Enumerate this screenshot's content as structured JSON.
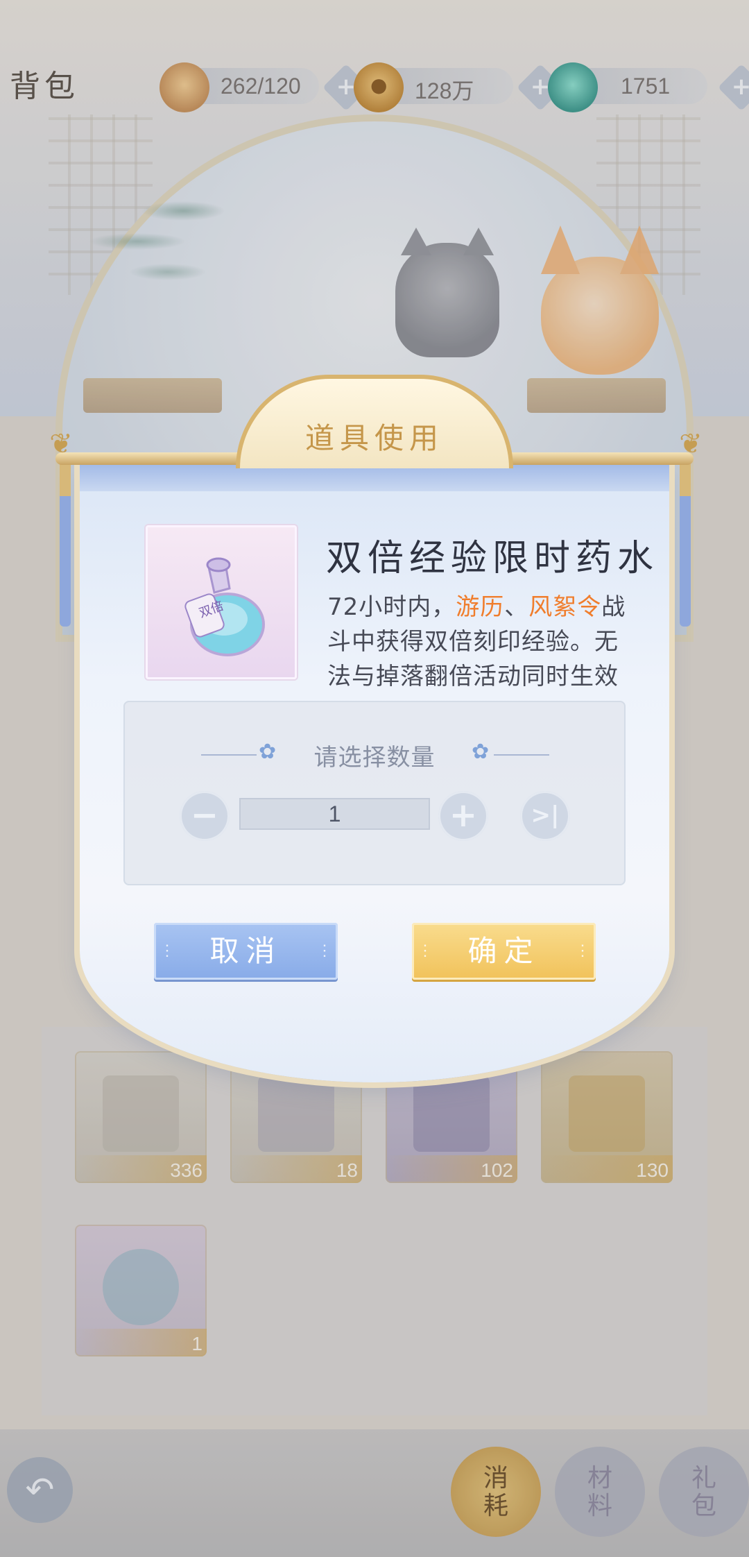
{
  "header": {
    "title": "背包",
    "resources": [
      {
        "icon": "cat-stamina-icon",
        "value": "262/120"
      },
      {
        "icon": "gold-coin-icon",
        "value": "128万"
      },
      {
        "icon": "jade-currency-icon",
        "value": "1751"
      }
    ]
  },
  "inventory": {
    "items": [
      {
        "icon": "scroll-book-icon",
        "count": "336"
      },
      {
        "icon": "book-icon",
        "count": "18"
      },
      {
        "icon": "scroll-bundle-icon",
        "count": "102"
      },
      {
        "icon": "golden-scroll-icon",
        "count": "130"
      },
      {
        "icon": "double-exp-potion-icon",
        "count": "1"
      }
    ]
  },
  "dialog": {
    "title": "道具使用",
    "item_name": "双倍经验限时药水",
    "desc_part1": "72小时内，",
    "desc_hl1": "游历",
    "desc_sep": "、",
    "desc_hl2": "风絮令",
    "desc_part2": "战斗中获得双倍刻印经验。无法与掉落翻倍活动同时生效",
    "potion_label": "双倍",
    "qty_prompt": "请选择数量",
    "quantity": "1",
    "cancel_label": "取消",
    "confirm_label": "确定",
    "highlight_color": "#f07d2c"
  },
  "nav": {
    "back_icon": "back-arrow-icon",
    "tabs": [
      "消耗",
      "材料",
      "礼包"
    ]
  }
}
